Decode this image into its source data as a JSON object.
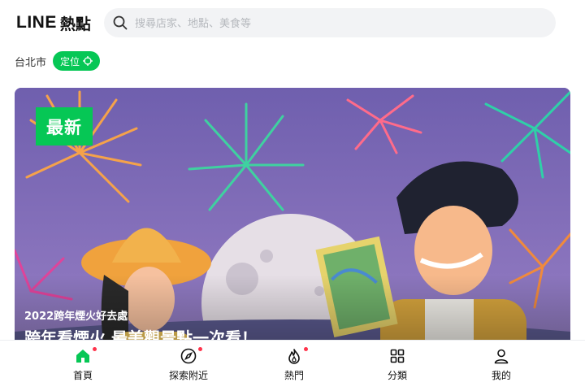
{
  "header": {
    "logo_text": "LINE",
    "logo_sub": "熱點",
    "search_placeholder": "搜尋店家、地點、美食等"
  },
  "location": {
    "label": "台北市",
    "chip_label": "定位"
  },
  "hero": {
    "badge": "最新",
    "subtitle": "2022跨年煙火好去處",
    "title": "跨年看煙火 最美觀景點一次看！"
  },
  "bottom_nav": [
    {
      "label": "首頁",
      "icon": "home-icon",
      "active": true,
      "dot": true
    },
    {
      "label": "探索附近",
      "icon": "compass-icon",
      "active": false,
      "dot": true
    },
    {
      "label": "熱門",
      "icon": "flame-icon",
      "active": false,
      "dot": true
    },
    {
      "label": "分類",
      "icon": "grid-icon",
      "active": false,
      "dot": false
    },
    {
      "label": "我的",
      "icon": "user-icon",
      "active": false,
      "dot": false
    }
  ],
  "colors": {
    "accent": "#06c755",
    "dot": "#ff334b",
    "hero_sky": "#7b6bb3"
  }
}
